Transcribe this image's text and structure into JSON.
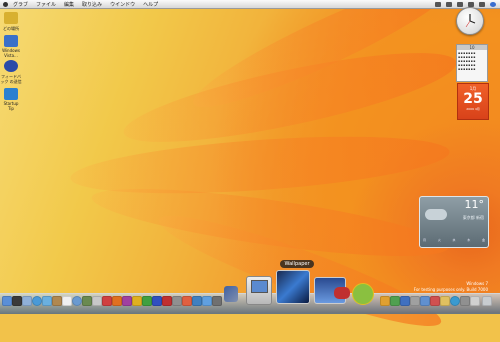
{
  "menubar": {
    "items": [
      "グラブ",
      "ファイル",
      "編集",
      "取り込み",
      "ウインドウ",
      "ヘルプ"
    ]
  },
  "desktop_icons": [
    {
      "label": "どの場所",
      "color": "#d8b030",
      "icon": "folder-icon"
    },
    {
      "label": "Windows Vista...",
      "color": "#3a70c8",
      "icon": "disk-icon"
    },
    {
      "label": "フィードバック の送信",
      "color": "#2a4aa8",
      "icon": "feedback-icon"
    },
    {
      "label": "Startup Tip",
      "color": "#2a80d0",
      "icon": "tip-icon"
    }
  ],
  "calendar": {
    "month": "10"
  },
  "date_widget": {
    "month": "1月",
    "day": "25",
    "year": "2009 4月"
  },
  "weather": {
    "temperature": "11°",
    "city": "東京都 新宿",
    "forecast": [
      "月",
      "火",
      "水",
      "木",
      "金"
    ]
  },
  "dock": {
    "tooltip": "Wallpaper"
  },
  "watermark": {
    "line1": "Windows 7",
    "line2": "For testing purposes only. Build 7000"
  },
  "colors": {
    "accent": "#f07a22",
    "date_widget": "#e85124"
  }
}
